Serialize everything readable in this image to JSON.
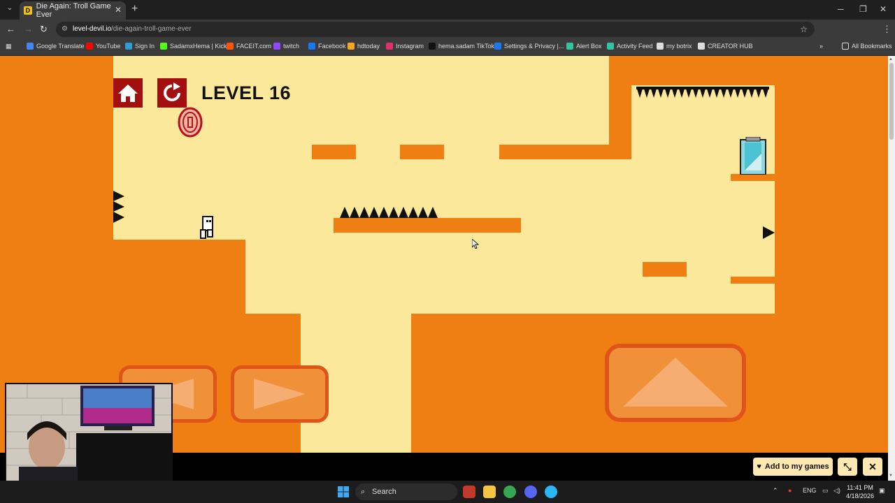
{
  "browser": {
    "tab_title": "Die Again: Troll Game Ever",
    "tab_favicon_letter": "D",
    "address_host": "level-devil.io",
    "address_path": "/die-again-troll-game-ever",
    "bookmarks": [
      {
        "label": "Google Translate",
        "color": "#4285f4"
      },
      {
        "label": "YouTube",
        "color": "#ff0000"
      },
      {
        "label": "Sign In",
        "color": "#2d9cdb"
      },
      {
        "label": "SadamxHema | Kick",
        "color": "#53fc18"
      },
      {
        "label": "FACEIT.com",
        "color": "#ff5500"
      },
      {
        "label": "twitch",
        "color": "#9146ff"
      },
      {
        "label": "Facebook",
        "color": "#1877f2"
      },
      {
        "label": "hdtoday",
        "color": "#f5a623"
      },
      {
        "label": "Instagram",
        "color": "#e1306c"
      },
      {
        "label": "hema.sadam TikTok",
        "color": "#111111"
      },
      {
        "label": "Settings & Privacy |...",
        "color": "#1877f2"
      },
      {
        "label": "Alert Box",
        "color": "#31c3a2"
      },
      {
        "label": "Activity Feed",
        "color": "#31c3a2"
      },
      {
        "label": "my botrix",
        "color": "#dddddd"
      },
      {
        "label": "CREATOR HUB",
        "color": "#dddddd"
      }
    ],
    "all_bookmarks_label": "All Bookmarks"
  },
  "game": {
    "level_label": "LEVEL 16",
    "colors": {
      "orange": "#f07f13",
      "cream": "#fce89a",
      "button_red": "#a30f0f",
      "control_fill": "#f0913a",
      "control_border": "#e0541a"
    }
  },
  "gamebar": {
    "add_label": "Add to my games",
    "heart_icon": "heart-icon",
    "expand_icon": "expand-icon",
    "close_icon": "close-icon"
  },
  "taskbar": {
    "search_placeholder": "Search",
    "lang": "ENG",
    "time": "11:41 PM",
    "date": "4/18/2026"
  }
}
